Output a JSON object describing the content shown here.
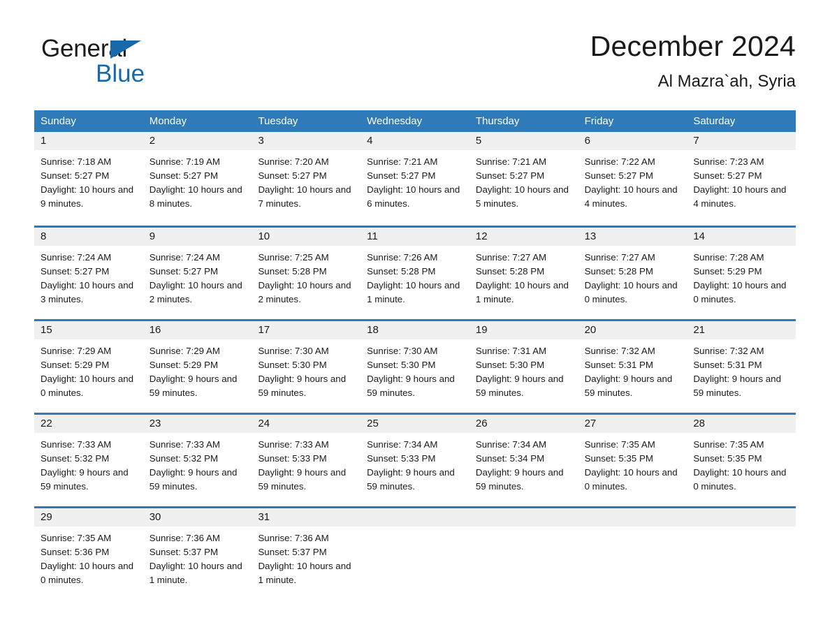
{
  "brand": {
    "word_one": "General",
    "word_two": "Blue",
    "triangle_icon": "triangle-icon",
    "accent_color": "#1769aa"
  },
  "header": {
    "title": "December 2024",
    "location": "Al Mazra`ah, Syria"
  },
  "theme": {
    "header_blue": "#2f7ab8",
    "row_rule_blue": "#2f7ab8",
    "daynum_band": "#f0f0f0",
    "text": "#1a1a1a"
  },
  "weekdays": [
    "Sunday",
    "Monday",
    "Tuesday",
    "Wednesday",
    "Thursday",
    "Friday",
    "Saturday"
  ],
  "weeks": [
    [
      {
        "day": "1",
        "sunrise": "Sunrise: 7:18 AM",
        "sunset": "Sunset: 5:27 PM",
        "daylight": "Daylight: 10 hours and 9 minutes."
      },
      {
        "day": "2",
        "sunrise": "Sunrise: 7:19 AM",
        "sunset": "Sunset: 5:27 PM",
        "daylight": "Daylight: 10 hours and 8 minutes."
      },
      {
        "day": "3",
        "sunrise": "Sunrise: 7:20 AM",
        "sunset": "Sunset: 5:27 PM",
        "daylight": "Daylight: 10 hours and 7 minutes."
      },
      {
        "day": "4",
        "sunrise": "Sunrise: 7:21 AM",
        "sunset": "Sunset: 5:27 PM",
        "daylight": "Daylight: 10 hours and 6 minutes."
      },
      {
        "day": "5",
        "sunrise": "Sunrise: 7:21 AM",
        "sunset": "Sunset: 5:27 PM",
        "daylight": "Daylight: 10 hours and 5 minutes."
      },
      {
        "day": "6",
        "sunrise": "Sunrise: 7:22 AM",
        "sunset": "Sunset: 5:27 PM",
        "daylight": "Daylight: 10 hours and 4 minutes."
      },
      {
        "day": "7",
        "sunrise": "Sunrise: 7:23 AM",
        "sunset": "Sunset: 5:27 PM",
        "daylight": "Daylight: 10 hours and 4 minutes."
      }
    ],
    [
      {
        "day": "8",
        "sunrise": "Sunrise: 7:24 AM",
        "sunset": "Sunset: 5:27 PM",
        "daylight": "Daylight: 10 hours and 3 minutes."
      },
      {
        "day": "9",
        "sunrise": "Sunrise: 7:24 AM",
        "sunset": "Sunset: 5:27 PM",
        "daylight": "Daylight: 10 hours and 2 minutes."
      },
      {
        "day": "10",
        "sunrise": "Sunrise: 7:25 AM",
        "sunset": "Sunset: 5:28 PM",
        "daylight": "Daylight: 10 hours and 2 minutes."
      },
      {
        "day": "11",
        "sunrise": "Sunrise: 7:26 AM",
        "sunset": "Sunset: 5:28 PM",
        "daylight": "Daylight: 10 hours and 1 minute."
      },
      {
        "day": "12",
        "sunrise": "Sunrise: 7:27 AM",
        "sunset": "Sunset: 5:28 PM",
        "daylight": "Daylight: 10 hours and 1 minute."
      },
      {
        "day": "13",
        "sunrise": "Sunrise: 7:27 AM",
        "sunset": "Sunset: 5:28 PM",
        "daylight": "Daylight: 10 hours and 0 minutes."
      },
      {
        "day": "14",
        "sunrise": "Sunrise: 7:28 AM",
        "sunset": "Sunset: 5:29 PM",
        "daylight": "Daylight: 10 hours and 0 minutes."
      }
    ],
    [
      {
        "day": "15",
        "sunrise": "Sunrise: 7:29 AM",
        "sunset": "Sunset: 5:29 PM",
        "daylight": "Daylight: 10 hours and 0 minutes."
      },
      {
        "day": "16",
        "sunrise": "Sunrise: 7:29 AM",
        "sunset": "Sunset: 5:29 PM",
        "daylight": "Daylight: 9 hours and 59 minutes."
      },
      {
        "day": "17",
        "sunrise": "Sunrise: 7:30 AM",
        "sunset": "Sunset: 5:30 PM",
        "daylight": "Daylight: 9 hours and 59 minutes."
      },
      {
        "day": "18",
        "sunrise": "Sunrise: 7:30 AM",
        "sunset": "Sunset: 5:30 PM",
        "daylight": "Daylight: 9 hours and 59 minutes."
      },
      {
        "day": "19",
        "sunrise": "Sunrise: 7:31 AM",
        "sunset": "Sunset: 5:30 PM",
        "daylight": "Daylight: 9 hours and 59 minutes."
      },
      {
        "day": "20",
        "sunrise": "Sunrise: 7:32 AM",
        "sunset": "Sunset: 5:31 PM",
        "daylight": "Daylight: 9 hours and 59 minutes."
      },
      {
        "day": "21",
        "sunrise": "Sunrise: 7:32 AM",
        "sunset": "Sunset: 5:31 PM",
        "daylight": "Daylight: 9 hours and 59 minutes."
      }
    ],
    [
      {
        "day": "22",
        "sunrise": "Sunrise: 7:33 AM",
        "sunset": "Sunset: 5:32 PM",
        "daylight": "Daylight: 9 hours and 59 minutes."
      },
      {
        "day": "23",
        "sunrise": "Sunrise: 7:33 AM",
        "sunset": "Sunset: 5:32 PM",
        "daylight": "Daylight: 9 hours and 59 minutes."
      },
      {
        "day": "24",
        "sunrise": "Sunrise: 7:33 AM",
        "sunset": "Sunset: 5:33 PM",
        "daylight": "Daylight: 9 hours and 59 minutes."
      },
      {
        "day": "25",
        "sunrise": "Sunrise: 7:34 AM",
        "sunset": "Sunset: 5:33 PM",
        "daylight": "Daylight: 9 hours and 59 minutes."
      },
      {
        "day": "26",
        "sunrise": "Sunrise: 7:34 AM",
        "sunset": "Sunset: 5:34 PM",
        "daylight": "Daylight: 9 hours and 59 minutes."
      },
      {
        "day": "27",
        "sunrise": "Sunrise: 7:35 AM",
        "sunset": "Sunset: 5:35 PM",
        "daylight": "Daylight: 10 hours and 0 minutes."
      },
      {
        "day": "28",
        "sunrise": "Sunrise: 7:35 AM",
        "sunset": "Sunset: 5:35 PM",
        "daylight": "Daylight: 10 hours and 0 minutes."
      }
    ],
    [
      {
        "day": "29",
        "sunrise": "Sunrise: 7:35 AM",
        "sunset": "Sunset: 5:36 PM",
        "daylight": "Daylight: 10 hours and 0 minutes."
      },
      {
        "day": "30",
        "sunrise": "Sunrise: 7:36 AM",
        "sunset": "Sunset: 5:37 PM",
        "daylight": "Daylight: 10 hours and 1 minute."
      },
      {
        "day": "31",
        "sunrise": "Sunrise: 7:36 AM",
        "sunset": "Sunset: 5:37 PM",
        "daylight": "Daylight: 10 hours and 1 minute."
      },
      {
        "day": "",
        "sunrise": "",
        "sunset": "",
        "daylight": ""
      },
      {
        "day": "",
        "sunrise": "",
        "sunset": "",
        "daylight": ""
      },
      {
        "day": "",
        "sunrise": "",
        "sunset": "",
        "daylight": ""
      },
      {
        "day": "",
        "sunrise": "",
        "sunset": "",
        "daylight": ""
      }
    ]
  ]
}
